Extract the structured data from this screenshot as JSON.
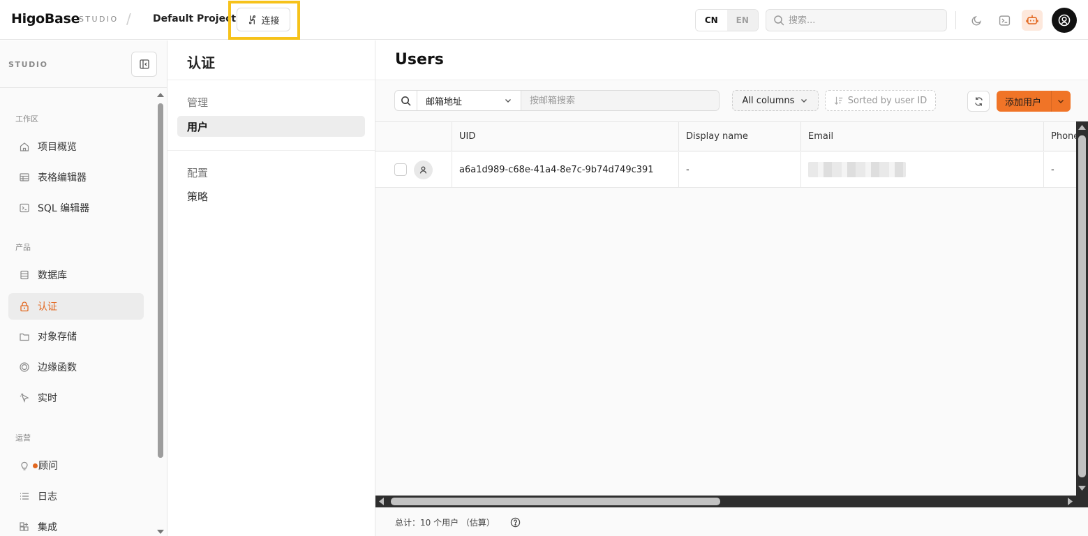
{
  "topbar": {
    "logo": "HigoBase",
    "studio_tag": "STUDIO",
    "separator": "/",
    "project": "Default Project",
    "connect_label": "连接",
    "lang_cn": "CN",
    "lang_en": "EN",
    "search_placeholder": "搜索...",
    "icons": [
      "moon-icon",
      "terminal-icon",
      "assistant-bot-icon",
      "user-avatar-icon"
    ],
    "accent": "#f07427",
    "highlight_color": "#f6c21a"
  },
  "sidebar": {
    "title": "STUDIO",
    "sections": [
      {
        "label": "工作区",
        "items": [
          {
            "label": "项目概览",
            "icon": "home-icon"
          },
          {
            "label": "表格编辑器",
            "icon": "table-icon"
          },
          {
            "label": "SQL 编辑器",
            "icon": "terminal-icon"
          }
        ]
      },
      {
        "label": "产品",
        "items": [
          {
            "label": "数据库",
            "icon": "database-icon"
          },
          {
            "label": "认证",
            "icon": "lock-icon",
            "active": true
          },
          {
            "label": "对象存储",
            "icon": "folder-icon"
          },
          {
            "label": "边缘函数",
            "icon": "functions-icon"
          },
          {
            "label": "实时",
            "icon": "pointer-icon"
          }
        ]
      },
      {
        "label": "运营",
        "items": [
          {
            "label": "顾问",
            "icon": "lightbulb-icon",
            "badge": true
          },
          {
            "label": "日志",
            "icon": "list-icon"
          },
          {
            "label": "集成",
            "icon": "grid-plus-icon"
          }
        ]
      }
    ]
  },
  "submenu": {
    "title": "认证",
    "groups": [
      {
        "label": "管理",
        "items": [
          {
            "label": "用户",
            "active": true
          }
        ]
      },
      {
        "label": "配置",
        "items": [
          {
            "label": "策略"
          }
        ]
      }
    ]
  },
  "main": {
    "title": "Users",
    "filter_field": "邮箱地址",
    "search_placeholder": "按邮箱搜索",
    "columns_label": "All columns",
    "sort_label": "Sorted by user ID",
    "add_user_label": "添加用户",
    "table": {
      "headers": [
        "UID",
        "Display name",
        "Email",
        "Phone"
      ],
      "rows": [
        {
          "uid": "a6a1d989-c68e-41a4-8e7c-9b74d749c391",
          "display_name": "-",
          "email": "",
          "phone": "-"
        }
      ]
    },
    "footer_count": "总计：10 个用户 （估算）"
  }
}
